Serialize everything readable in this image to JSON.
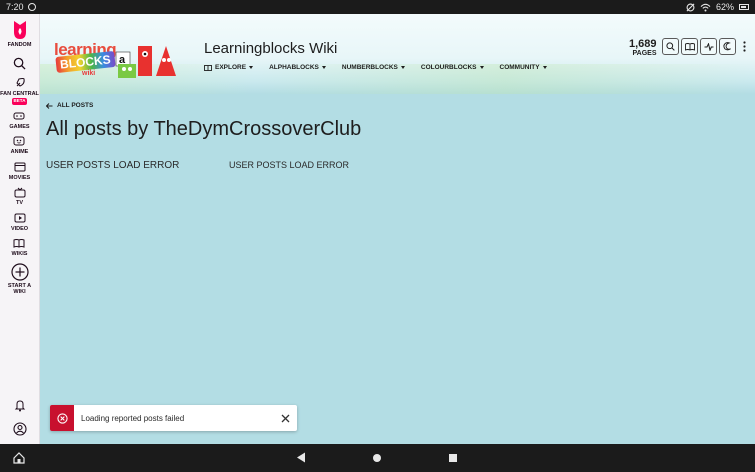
{
  "status_bar": {
    "time": "7:20",
    "battery": "62%"
  },
  "rail": {
    "brand": "FANDOM",
    "items": [
      {
        "label": "FAN CENTRAL",
        "badge": "BETA",
        "icon": "rocket-icon"
      },
      {
        "label": "GAMES",
        "icon": "gamepad-icon"
      },
      {
        "label": "ANIME",
        "icon": "anime-icon"
      },
      {
        "label": "MOVIES",
        "icon": "clapper-icon"
      },
      {
        "label": "TV",
        "icon": "tv-icon"
      },
      {
        "label": "VIDEO",
        "icon": "play-icon"
      },
      {
        "label": "WIKIS",
        "icon": "book-icon"
      },
      {
        "label": "START A WIKI",
        "icon": "plus-circle-icon"
      }
    ]
  },
  "header": {
    "logo": {
      "word1": "learning",
      "word2": "BLOCKS",
      "word3": "wiki"
    },
    "title": "Learningblocks Wiki",
    "nav": [
      {
        "label": "EXPLORE"
      },
      {
        "label": "ALPHABLOCKS"
      },
      {
        "label": "NUMBERBLOCKS"
      },
      {
        "label": "COLOURBLOCKS"
      },
      {
        "label": "COMMUNITY"
      }
    ],
    "pages_count": "1,689",
    "pages_label": "PAGES"
  },
  "content": {
    "back_label": "ALL POSTS",
    "title": "All posts by TheDymCrossoverClub",
    "error_left": "USER POSTS LOAD ERROR",
    "error_right": "USER POSTS LOAD ERROR"
  },
  "toast": {
    "message": "Loading reported posts failed"
  },
  "colors": {
    "accent": "#fa005a",
    "error": "#c8102e",
    "background": "#b3dde4"
  }
}
